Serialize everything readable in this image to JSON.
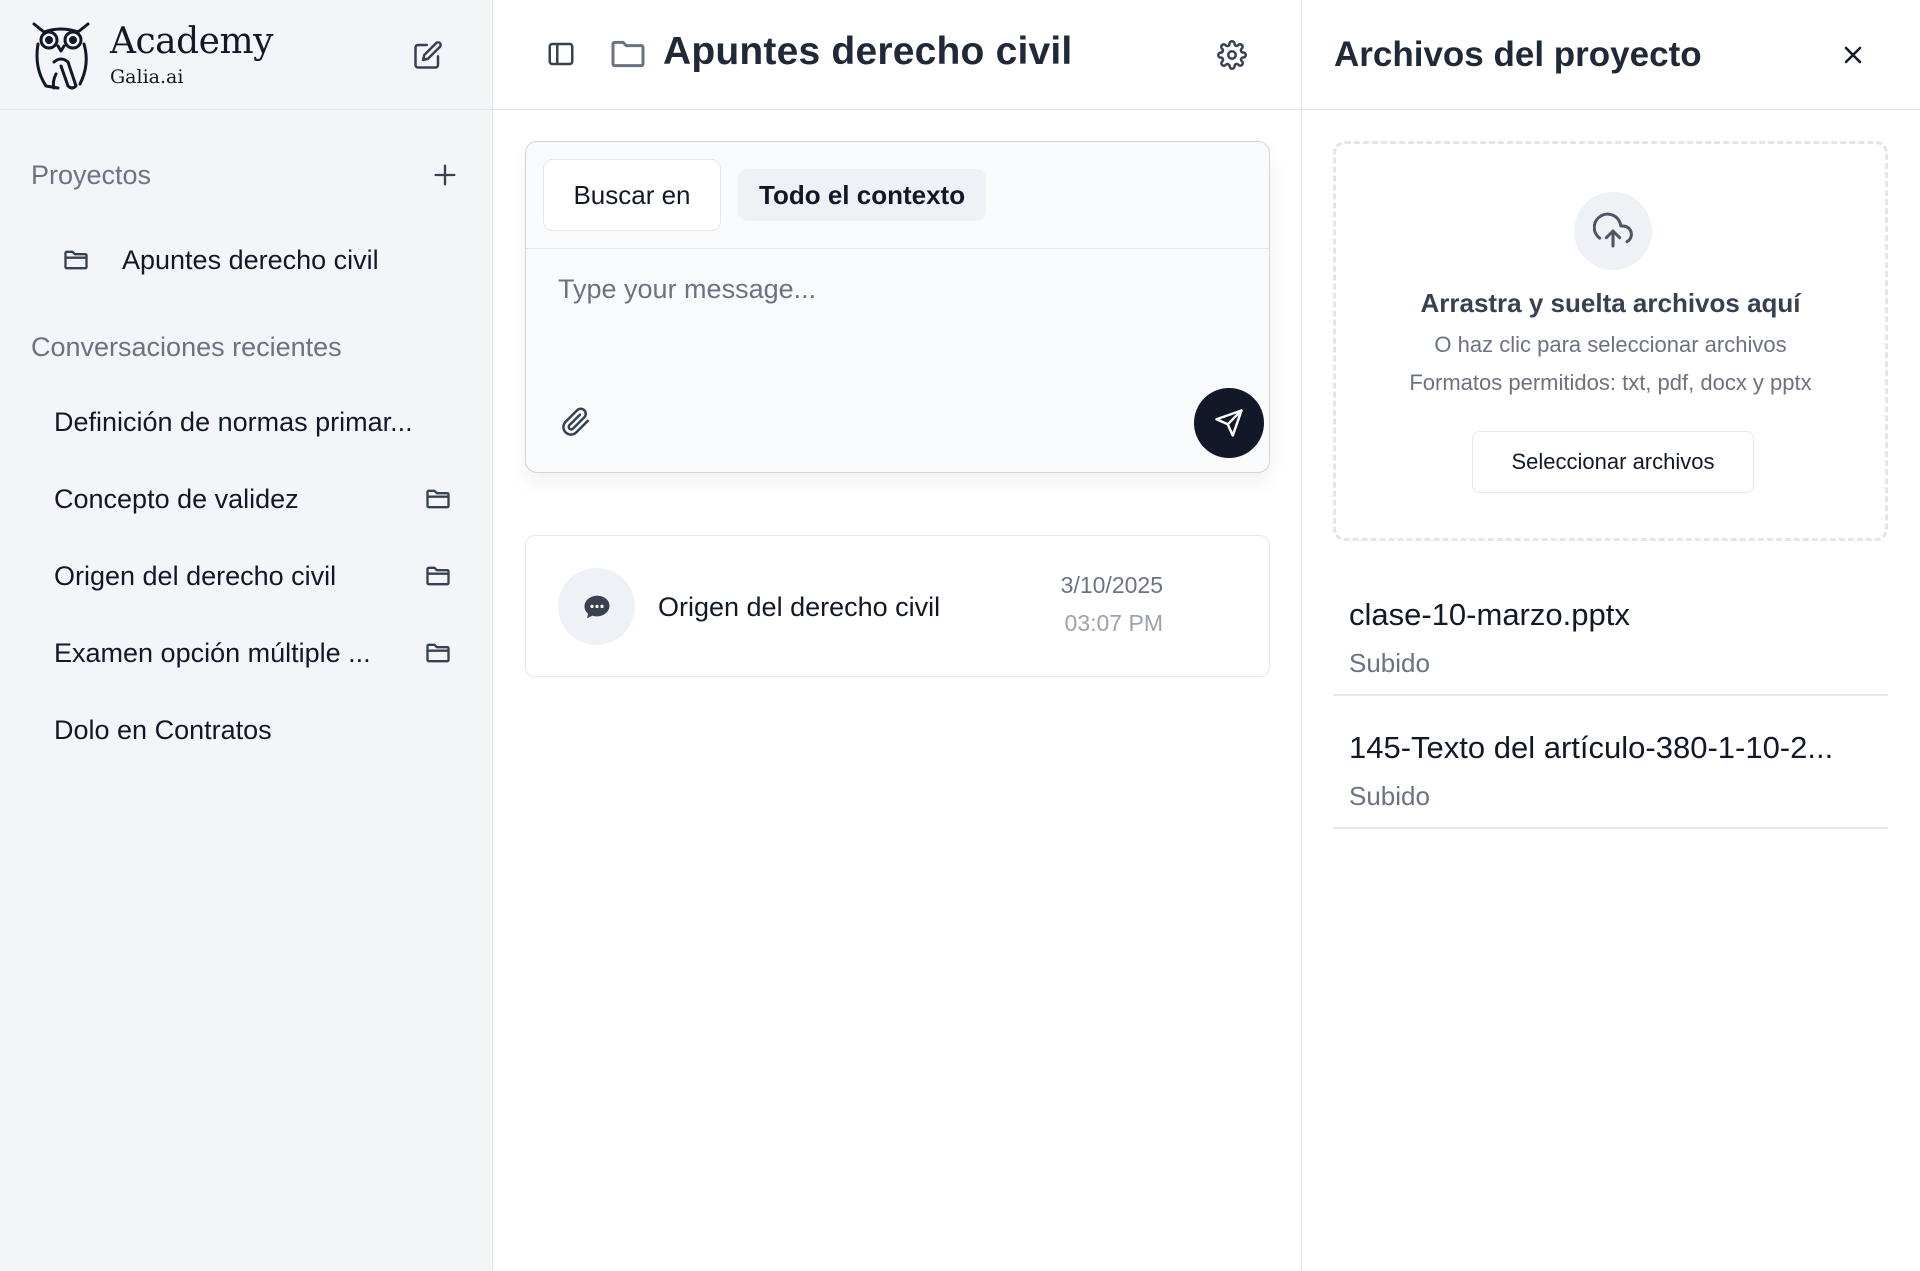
{
  "brand": {
    "name": "Academy",
    "sub": "Galia.ai"
  },
  "sidebar": {
    "projects_title": "Proyectos",
    "projects": [
      {
        "label": "Apuntes derecho civil"
      }
    ],
    "recent_title": "Conversaciones recientes",
    "conversations": [
      {
        "label": "Definición de normas primar...",
        "in_project": false
      },
      {
        "label": "Concepto de validez",
        "in_project": true
      },
      {
        "label": "Origen del derecho civil",
        "in_project": true
      },
      {
        "label": "Examen opción múltiple ...",
        "in_project": true
      },
      {
        "label": "Dolo en Contratos",
        "in_project": false
      }
    ]
  },
  "main": {
    "title": "Apuntes derecho civil",
    "composer": {
      "search_in": "Buscar en",
      "context": "Todo el contexto",
      "placeholder": "Type your message..."
    },
    "conversation_card": {
      "title": "Origen del derecho civil",
      "date": "3/10/2025",
      "time": "03:07 PM"
    }
  },
  "files_panel": {
    "title": "Archivos del proyecto",
    "dropzone": {
      "title": "Arrastra y suelta archivos aquí",
      "subtitle": "O haz clic para seleccionar archivos",
      "formats": "Formatos permitidos: txt, pdf, docx y pptx",
      "button": "Seleccionar archivos"
    },
    "files": [
      {
        "name": "clase-10-marzo.pptx",
        "status": "Subido"
      },
      {
        "name": "145-Texto del artículo-380-1-10-2...",
        "status": "Subido"
      }
    ]
  },
  "colors": {
    "sidebar_bg": "#f3f5f8",
    "send_button": "#111827",
    "muted_text": "#6b7280",
    "border": "#e5e7eb"
  },
  "icons": {
    "logo": "owl-logo-icon",
    "new_chat": "edit-icon",
    "add_project": "plus-icon",
    "project": "folder-icon",
    "toggle_sidebar": "sidebar-toggle-icon",
    "settings": "gear-icon",
    "attach": "paperclip-icon",
    "send": "send-icon",
    "conversation": "chat-bubble-icon",
    "close": "close-icon",
    "upload": "cloud-upload-icon"
  }
}
